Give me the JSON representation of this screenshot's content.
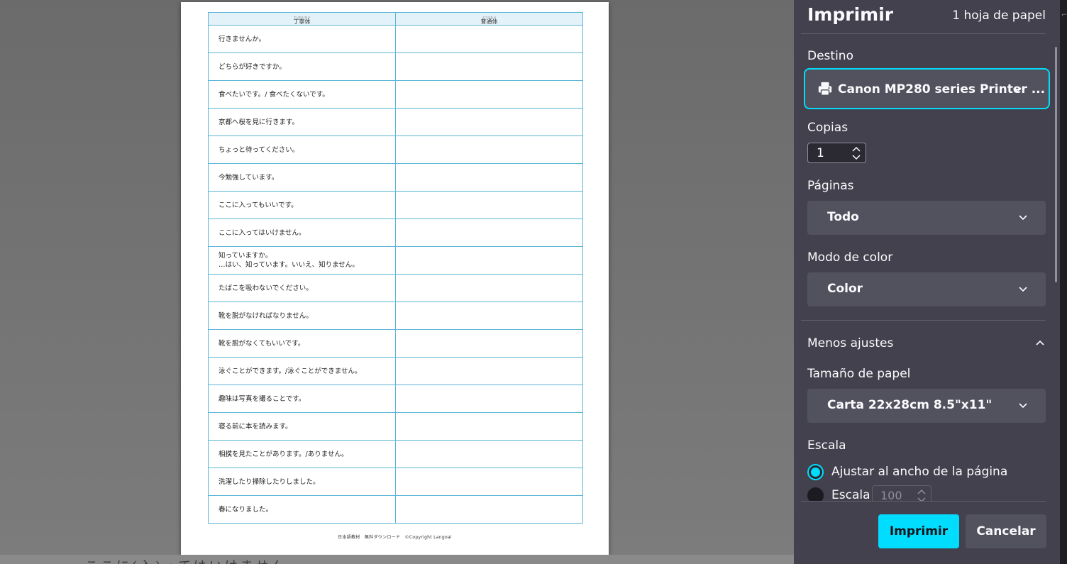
{
  "preview": {
    "table": {
      "headers": [
        {
          "ruby": "ていねいたい",
          "text": "丁寧体"
        },
        {
          "ruby": "ふつうたい",
          "text": "普通体"
        }
      ],
      "rows": [
        [
          "行きませんか。"
        ],
        [
          "どちらが好きですか。"
        ],
        [
          "食べたいです。/ 食べたくないです。"
        ],
        [
          "京都へ桜を見に行きます。"
        ],
        [
          "ちょっと待ってください。"
        ],
        [
          "今勉強しています。"
        ],
        [
          "ここに入ってもいいです。"
        ],
        [
          "ここに入ってはいけません。"
        ],
        [
          "知っていますか。",
          "…はい、知っています。いいえ、知りません。"
        ],
        [
          "たばこを吸わないでください。"
        ],
        [
          "靴を脱がなければなりません。"
        ],
        [
          "靴を脱がなくてもいいです。"
        ],
        [
          "泳ぐことができます。/泳ぐことができません。"
        ],
        [
          "趣味は写真を撮ることです。"
        ],
        [
          "寝る前に本を読みます。"
        ],
        [
          "相撲を見たことがあります。/ありません。"
        ],
        [
          "洗濯したり掃除したりしました。"
        ],
        [
          "春になりました。"
        ]
      ]
    },
    "footer": "日本語教材　無料ダウンロード　©Copyright Langoal",
    "background_text": "ここに(入)ってはいけません"
  },
  "panel": {
    "title": "Imprimir",
    "sheets": "1 hoja de papel",
    "destination": {
      "label": "Destino",
      "value": "Canon MP280 series Printer ..."
    },
    "copies": {
      "label": "Copias",
      "value": "1"
    },
    "pages": {
      "label": "Páginas",
      "value": "Todo"
    },
    "color_mode": {
      "label": "Modo de color",
      "value": "Color"
    },
    "more_settings": {
      "label": "Menos ajustes"
    },
    "paper_size": {
      "label": "Tamaño de papel",
      "value": "Carta 22x28cm 8.5\"x11\""
    },
    "scale": {
      "label": "Escala",
      "fit_option": "Ajustar al ancho de la página",
      "custom_option": "Escala",
      "custom_value": "100"
    },
    "buttons": {
      "print": "Imprimir",
      "cancel": "Cancelar"
    }
  },
  "colors": {
    "accent": "#00ddff",
    "panel_bg": "#42414d",
    "control_bg": "#52515e",
    "table_border": "#5bb5d6"
  }
}
